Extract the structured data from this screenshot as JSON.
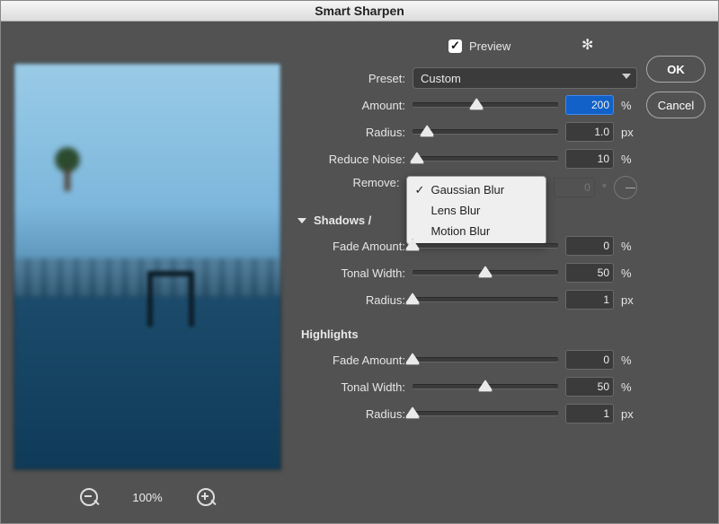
{
  "title": "Smart Sharpen",
  "preview": {
    "checkbox_label": "Preview",
    "checked": true
  },
  "buttons": {
    "ok": "OK",
    "cancel": "Cancel"
  },
  "preset": {
    "label": "Preset:",
    "value": "Custom"
  },
  "sliders": {
    "amount": {
      "label": "Amount:",
      "value": "200",
      "unit": "%",
      "pos": 44,
      "selected": true
    },
    "radius": {
      "label": "Radius:",
      "value": "1.0",
      "unit": "px",
      "pos": 10
    },
    "reduceNoise": {
      "label": "Reduce Noise:",
      "value": "10",
      "unit": "%",
      "pos": 3
    }
  },
  "remove": {
    "label": "Remove:",
    "options": [
      "Gaussian Blur",
      "Lens Blur",
      "Motion Blur"
    ],
    "selected": "Gaussian Blur",
    "angle": {
      "value": "0",
      "unit": "°"
    }
  },
  "sections": {
    "shadowsHighlights": "Shadows /",
    "shadows": {
      "fade": {
        "label": "Fade Amount:",
        "value": "0",
        "unit": "%",
        "pos": 0
      },
      "tonal": {
        "label": "Tonal Width:",
        "value": "50",
        "unit": "%",
        "pos": 50
      },
      "radius": {
        "label": "Radius:",
        "value": "1",
        "unit": "px",
        "pos": 0
      }
    },
    "highlights_label": "Highlights",
    "highlights": {
      "fade": {
        "label": "Fade Amount:",
        "value": "0",
        "unit": "%",
        "pos": 0
      },
      "tonal": {
        "label": "Tonal Width:",
        "value": "50",
        "unit": "%",
        "pos": 50
      },
      "radius": {
        "label": "Radius:",
        "value": "1",
        "unit": "px",
        "pos": 0
      }
    }
  },
  "zoom": {
    "level": "100%"
  }
}
